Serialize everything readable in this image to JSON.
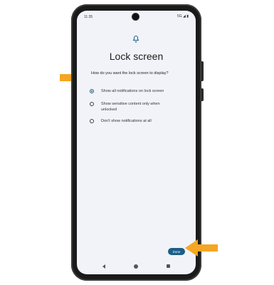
{
  "status": {
    "time": "11:35",
    "icons": "5G ◢ ▮"
  },
  "icons": {
    "header": "bell-icon",
    "annotation": "orange-arrow-icon"
  },
  "page": {
    "title": "Lock screen",
    "question": "How do you want the lock screen to display?"
  },
  "options": [
    {
      "label": "Show all notifications on lock screen",
      "selected": true
    },
    {
      "label": "Show sensitive content only when unlocked",
      "selected": false
    },
    {
      "label": "Don't show notifications at all",
      "selected": false
    }
  ],
  "done_label": "Done",
  "colors": {
    "accent": "#1b5e88",
    "arrow": "#f5a623",
    "screen": "#f1f3f8",
    "bezel": "#1a1a1a"
  }
}
